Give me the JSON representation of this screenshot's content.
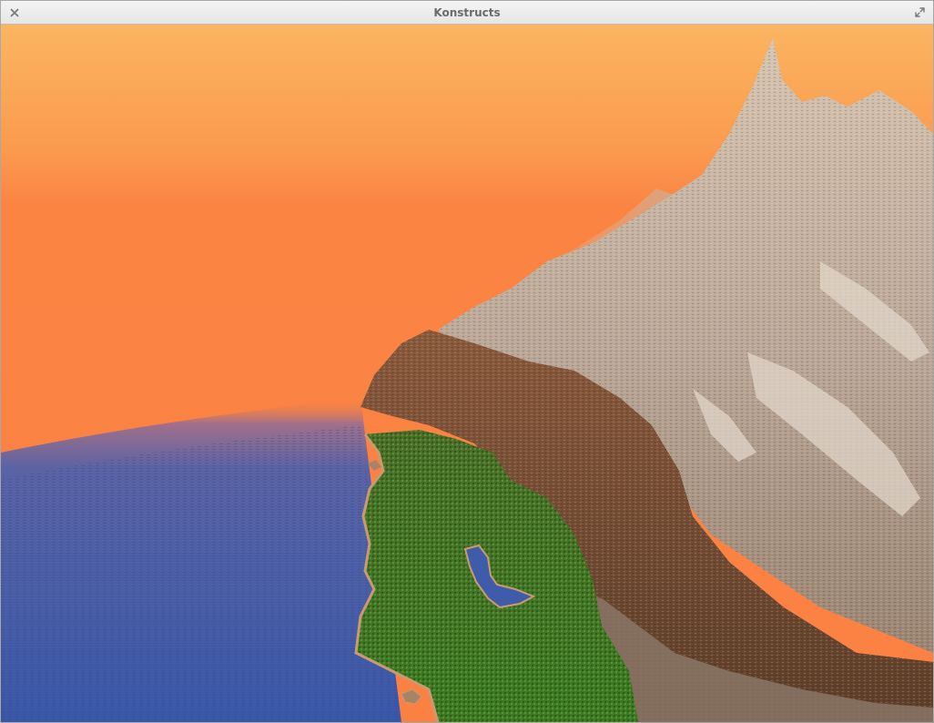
{
  "window": {
    "title": "Konstructs"
  },
  "icons": {
    "close": "close-icon",
    "maximize": "maximize-icon"
  },
  "scene": {
    "sky_top": "#fbb561",
    "sky_horizon": "#fb8142",
    "water": "#3c5aa8",
    "water_far": "#7a6fa0",
    "forest": "#3f7a25",
    "forest_dark": "#2d5a1a",
    "rock_brown": "#6e4a30",
    "rock_light": "#b9a48f",
    "snow": "#ddd2c4",
    "sand": "#c99a70"
  }
}
